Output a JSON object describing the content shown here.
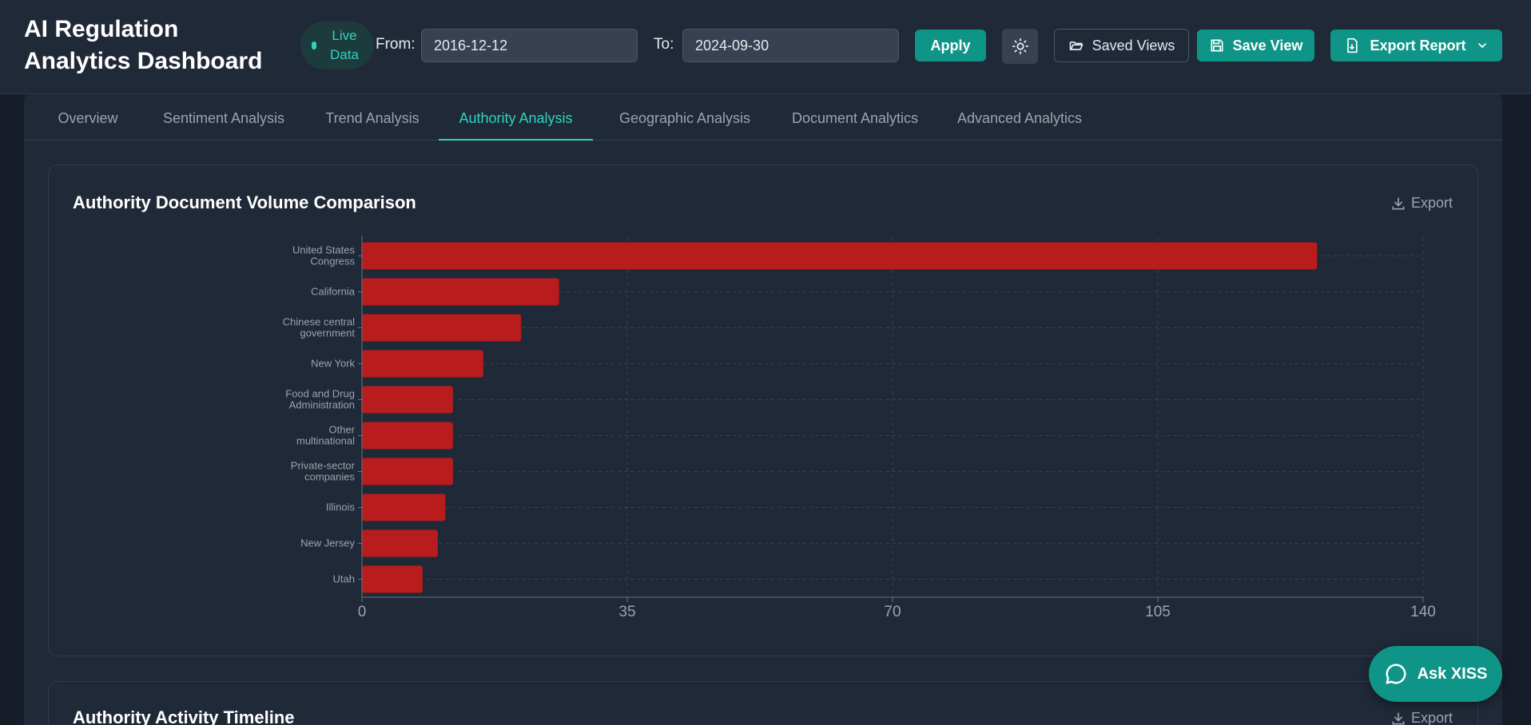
{
  "header": {
    "title_line1": "AI Regulation",
    "title_line2": "Analytics Dashboard",
    "live_badge_line1": "Live",
    "live_badge_line2": "Data",
    "from_label": "From:",
    "from_value": "2016-12-12",
    "to_label": "To:",
    "to_value": "2024-09-30",
    "apply_label": "Apply",
    "theme_icon": "sun-icon",
    "saved_views_label": "Saved Views",
    "save_view_label": "Save View",
    "export_report_label": "Export Report"
  },
  "tabs": [
    {
      "label": "Overview",
      "active": false
    },
    {
      "label": "Sentiment Analysis",
      "active": false
    },
    {
      "label": "Trend Analysis",
      "active": false
    },
    {
      "label": "Authority Analysis",
      "active": true
    },
    {
      "label": "Geographic Analysis",
      "active": false
    },
    {
      "label": "Document Analytics",
      "active": false
    },
    {
      "label": "Advanced Analytics",
      "active": false
    }
  ],
  "card1": {
    "title": "Authority Document Volume Comparison",
    "export_label": "Export"
  },
  "card2": {
    "title": "Authority Activity Timeline",
    "export_label": "Export"
  },
  "ask_button": {
    "label": "Ask XISS"
  },
  "colors": {
    "accent": "#0f9488",
    "accent_text": "#2dd4bf",
    "bar": "#b91c1c"
  },
  "chart_data": {
    "type": "bar",
    "orientation": "horizontal",
    "title": "Authority Document Volume Comparison",
    "categories": [
      [
        "United States",
        "Congress"
      ],
      [
        "California"
      ],
      [
        "Chinese central",
        "government"
      ],
      [
        "New York"
      ],
      [
        "Food and Drug",
        "Administration"
      ],
      [
        "Other",
        "multinational"
      ],
      [
        "Private-sector",
        "companies"
      ],
      [
        "Illinois"
      ],
      [
        "New Jersey"
      ],
      [
        "Utah"
      ]
    ],
    "values": [
      126,
      26,
      21,
      16,
      12,
      12,
      12,
      11,
      10,
      8
    ],
    "xlim": [
      0,
      140
    ],
    "xticks": [
      0,
      35,
      70,
      105,
      140
    ],
    "grid": true,
    "legend": "none"
  }
}
